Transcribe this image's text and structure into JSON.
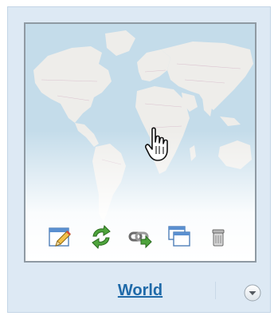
{
  "map_card": {
    "title": "World",
    "toolbar": {
      "items": [
        {
          "name": "edit-icon",
          "action": "edit"
        },
        {
          "name": "refresh-icon",
          "action": "refresh"
        },
        {
          "name": "link-icon",
          "action": "link"
        },
        {
          "name": "windows-icon",
          "action": "open"
        },
        {
          "name": "trash-icon",
          "action": "delete"
        }
      ]
    },
    "menu": {
      "icon": "chevron-down-icon"
    },
    "cursor": {
      "icon": "hand-pointer-icon"
    }
  },
  "colors": {
    "card_background": "#dde9f4",
    "link": "#1f6aa9",
    "ocean": "#c4dcea",
    "land": "#eeedea",
    "thumbnail_border": "#8f9aa3"
  }
}
